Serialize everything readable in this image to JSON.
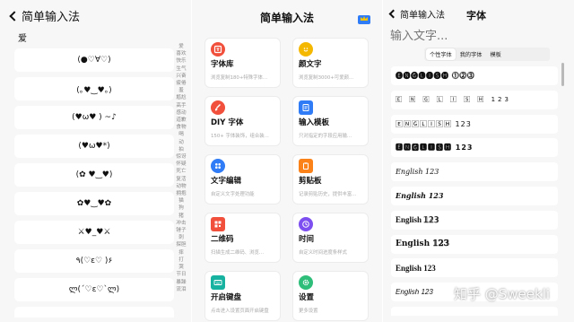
{
  "emoticons": {
    "back_label": "简单输入法",
    "section_title": "爱",
    "items": [
      "(●♡∀♡)",
      "(｡♥‿♥｡)",
      "(♥ω♥ ) ~♪",
      "(♥ω♥*)",
      "(✿ ♥‿♥)",
      "✿♥‿♥✿",
      "⚔♥_♥⚔",
      "٩(♡ε♡ )۶",
      "ლ(´♡ε♡`ლ)",
      ""
    ],
    "index": [
      "爱",
      "喜欢",
      "快乐",
      "生气",
      "兴奋",
      "疲倦",
      "羞",
      "尴尬",
      "高手",
      "感动",
      "道歉",
      "食物",
      "喝",
      "动",
      "拍",
      "惊讶",
      "怀疑",
      "死亡",
      "复活",
      "动物",
      "拥抱",
      "猫",
      "狗",
      "猪",
      "冲击",
      "锤子",
      "刺",
      "探胆",
      "摔",
      "打",
      "哭",
      "节日",
      "暴躁",
      "流泪"
    ]
  },
  "home": {
    "title": "简单输入法",
    "icon_colors": {
      "red": "#f0503c",
      "yellow": "#f5b800",
      "orange": "#fa8219",
      "blue": "#2f7cf6",
      "purple": "#7d4ff0",
      "teal": "#17b2a0",
      "green": "#2fbd7a"
    },
    "cards": [
      {
        "title": "字体库",
        "desc": "浏览复制180+特殊字体...",
        "icon": "font-library-icon",
        "color": "#f0503c"
      },
      {
        "title": "颜文字",
        "desc": "浏览复制3000+可爱颜...",
        "icon": "smiley-icon",
        "color": "#f5b800"
      },
      {
        "title": "DIY 字体",
        "desc": "150+ 字体装饰，组合装...",
        "icon": "brush-icon",
        "color": "#f0503c"
      },
      {
        "title": "输入模板",
        "desc": "只对指定的字段应用输...",
        "icon": "template-icon",
        "color": "#2f7cf6"
      },
      {
        "title": "文字编辑",
        "desc": "自定义文字处理功能",
        "icon": "text-edit-icon",
        "color": "#2f7cf6"
      },
      {
        "title": "剪贴板",
        "desc": "记录剪贴历史，提供丰富...",
        "icon": "clipboard-icon",
        "color": "#fa8219"
      },
      {
        "title": "二维码",
        "desc": "扫描生成二维码、浏览...",
        "icon": "qrcode-icon",
        "color": "#f0503c"
      },
      {
        "title": "时间",
        "desc": "自定义时间进度条样式",
        "icon": "clock-icon",
        "color": "#7d4ff0"
      },
      {
        "title": "开启键盘",
        "desc": "点击进入设置页面开启键盘",
        "icon": "keyboard-icon",
        "color": "#17b2a0"
      },
      {
        "title": "设置",
        "desc": "更多设置",
        "icon": "gear-icon",
        "color": "#2fbd7a"
      }
    ]
  },
  "fonts": {
    "back_label": "简单输入法",
    "title": "字体",
    "input_placeholder": "输入文字...",
    "tabs": [
      "个性字体",
      "我的字体",
      "模板"
    ],
    "active_tab": "个性字体",
    "samples": [
      "🅔🅝🅖🅛🅘🅢🅗 ⓵⓶⓷",
      "🄴 🄽 🄶 🄻 🄸 🅂 🄷  123",
      "🄴🄽🄶🄻🄸🅂🄷 123",
      "🅴🅽🅶🅻🅸🆂🅷 123",
      "English 123",
      "English 123",
      "English 𝟙𝟚𝟛",
      "English 𝟙𝟚𝟛",
      "English 123",
      "English 123",
      ""
    ]
  },
  "watermark": "知乎 @Sweekli"
}
